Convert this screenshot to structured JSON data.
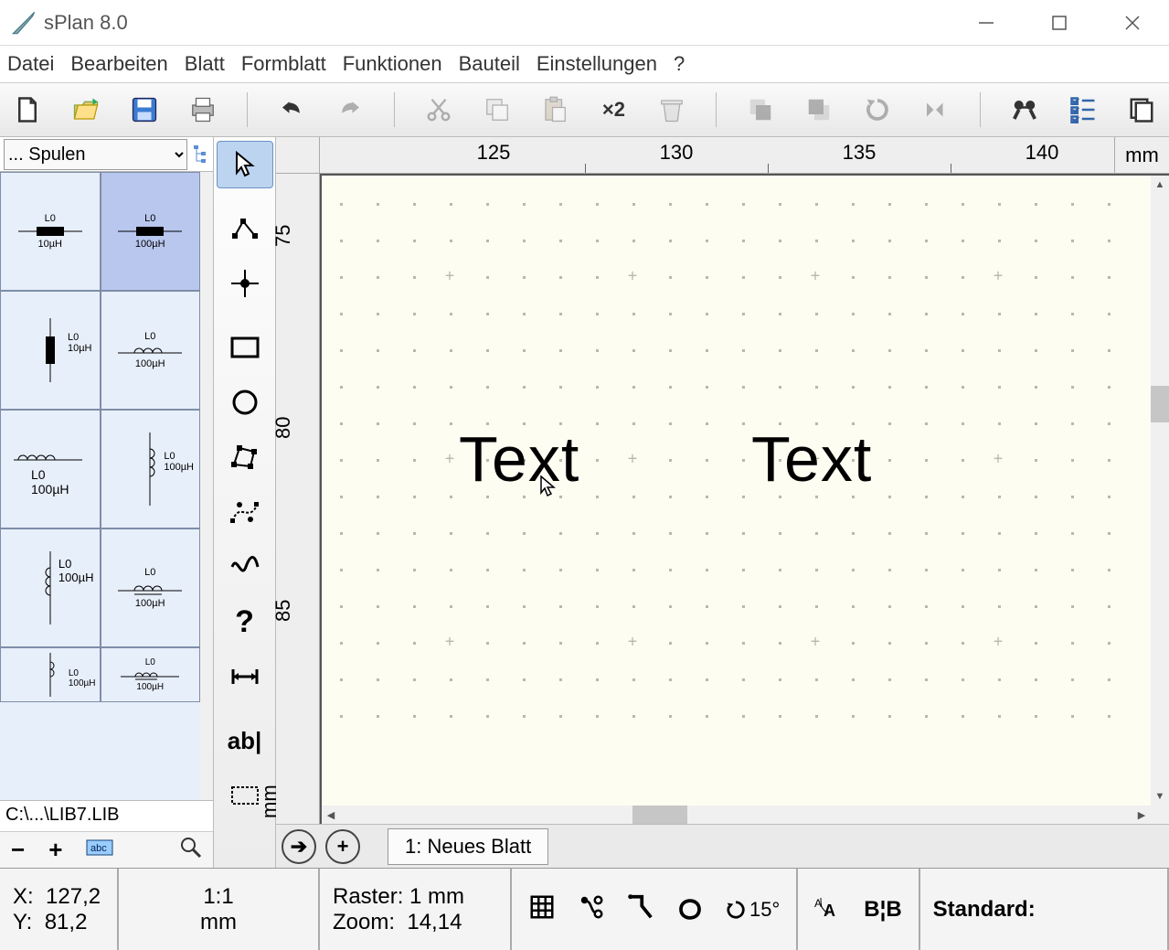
{
  "app": {
    "title": "sPlan 8.0"
  },
  "menu": {
    "items": [
      "Datei",
      "Bearbeiten",
      "Blatt",
      "Formblatt",
      "Funktionen",
      "Bauteil",
      "Einstellungen",
      "?"
    ]
  },
  "library": {
    "selector": "... Spulen",
    "file": "C:\\...\\LIB7.LIB",
    "cells": [
      {
        "id": "L0",
        "val": "10µH"
      },
      {
        "id": "L0",
        "val": "100µH"
      },
      {
        "id": "L0",
        "val": "10µH"
      },
      {
        "id": "L0",
        "val": "100µH"
      },
      {
        "id": "L0",
        "val": "100µH"
      },
      {
        "id": "L0",
        "val": "100µH"
      },
      {
        "id": "L0",
        "val": "100µH"
      },
      {
        "id": "L0",
        "val": "100µH"
      },
      {
        "id": "L0",
        "val": "100µH"
      },
      {
        "id": "L0",
        "val": "100µH"
      }
    ]
  },
  "ruler": {
    "h": [
      "125",
      "130",
      "135",
      "140"
    ],
    "v": [
      "75",
      "80",
      "85"
    ],
    "unit_h": "mm",
    "unit_v": "mm"
  },
  "canvas": {
    "text1": "Text",
    "text2": "Text"
  },
  "sheet": {
    "tab": "1: Neues Blatt"
  },
  "status": {
    "x_label": "X:",
    "x_val": "127,2",
    "y_label": "Y:",
    "y_val": "81,2",
    "scale": "1:1",
    "scale_unit": "mm",
    "raster": "Raster: 1 mm",
    "zoom_label": "Zoom:",
    "zoom_val": "14,14",
    "angle": "15°",
    "style": "Standard:"
  }
}
